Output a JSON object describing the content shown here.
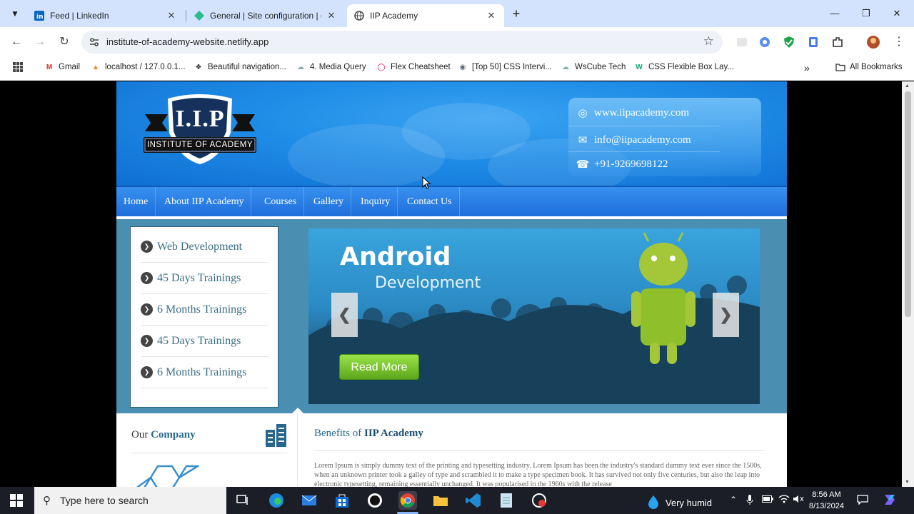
{
  "browser": {
    "tabs": [
      {
        "title": "Feed | LinkedIn",
        "icon": "linkedin-icon"
      },
      {
        "title": "General | Site configuration | d",
        "icon": "netlify-icon"
      },
      {
        "title": "IIP Academy",
        "icon": "globe-icon",
        "active": true
      }
    ],
    "url": "institute-of-academy-website.netlify.app",
    "bookmarks": [
      "Gmail",
      "localhost / 127.0.0.1...",
      "Beautiful navigation...",
      "4. Media Query",
      "Flex Cheatsheet",
      "[Top 50] CSS Intervi...",
      "WsCube Tech",
      "CSS Flexible Box Lay..."
    ],
    "all_bookmarks": "All Bookmarks"
  },
  "site": {
    "logo": {
      "letters": "I.I.P",
      "subtitle": "INSTITUTE OF ACADEMY"
    },
    "contact": {
      "website": "www.iipacademy.com",
      "email": "info@iipacademy.com",
      "phone": "+91-9269698122"
    },
    "nav": [
      "Home",
      "About IIP Academy",
      "Courses",
      "Gallery",
      "Inquiry",
      "Contact Us"
    ],
    "courses": [
      "Web Development",
      "45 Days Trainings",
      "6 Months Trainings",
      "45 Days Trainings",
      "6 Months Trainings"
    ],
    "slide": {
      "title": "Android",
      "subtitle": "Development",
      "button": "Read More"
    },
    "our_company": {
      "prefix": "Our ",
      "bold": "Company"
    },
    "benefits": {
      "prefix": "Benefits of ",
      "bold": "IIP Academy"
    },
    "lorem": "Lorem Ipsum is simply dummy text of the printing and typesetting industry. Lorem Ipsum has been the industry's standard dummy text ever since the 1500s, when an unknown printer took a galley of type and scrambled it to make a type specimen book. It has survived not only five centuries, but also the leap into electronic typesetting, remaining essentially unchanged. It was popularised in the 1960s with the release"
  },
  "taskbar": {
    "search_placeholder": "Type here to search",
    "weather": "Very humid",
    "time": "8:56 AM",
    "date": "8/13/2024"
  },
  "colors": {
    "header_blue": "#1e8ce6",
    "nav_blue": "#2a7fe5",
    "hero_bg": "#4a8fb2",
    "course_text": "#3b6f86",
    "read_more_green": "#7cc832",
    "chrome_tabstrip": "#d3e3fd"
  }
}
